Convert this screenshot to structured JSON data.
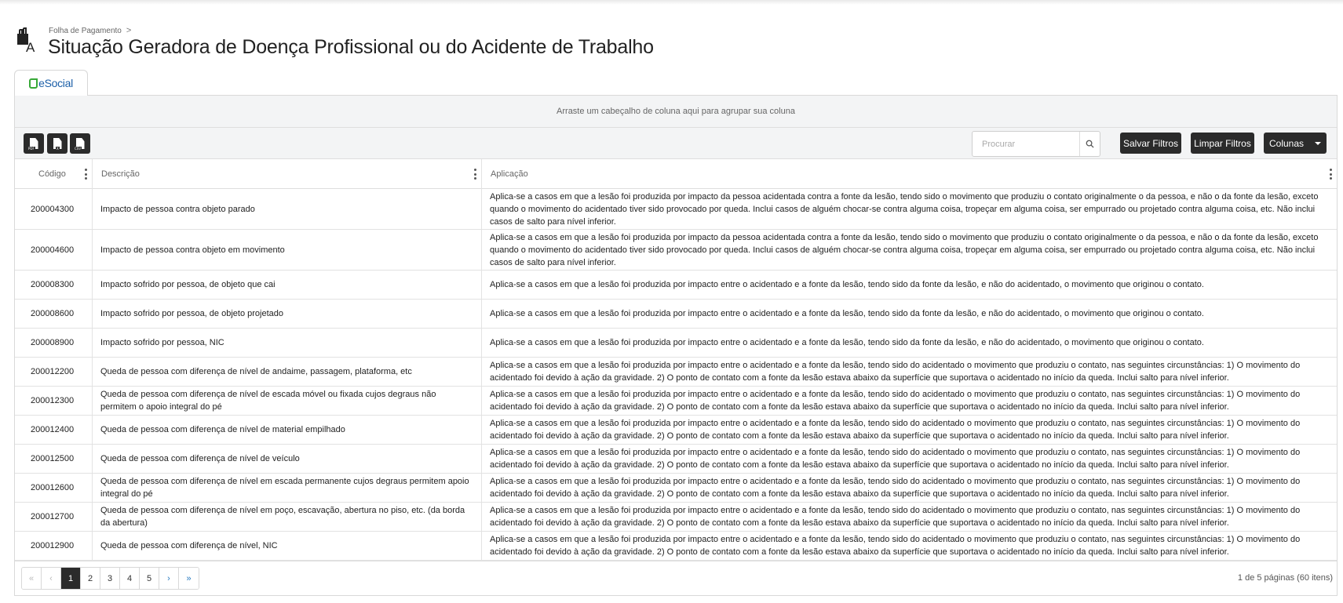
{
  "breadcrumb": {
    "parent": "Folha de Pagamento",
    "separator": ">"
  },
  "page_title": "Situação Geradora de Doença Profissional ou do Acidente de Trabalho",
  "tabs": [
    {
      "label": "eSocial",
      "icon": "esocial-logo"
    }
  ],
  "grid": {
    "group_hint": "Arraste um cabeçalho de coluna aqui para agrupar sua coluna",
    "export_buttons": [
      {
        "name": "export-pdf-button",
        "icon": "pdf-file-icon",
        "tag": "PDF"
      },
      {
        "name": "export-xls-button",
        "icon": "excel-file-icon",
        "tag": "X"
      },
      {
        "name": "export-csv-button",
        "icon": "csv-file-icon",
        "tag": "CSV"
      }
    ],
    "search": {
      "placeholder": "Procurar",
      "value": "",
      "icon": "search-icon"
    },
    "buttons": {
      "save_filters": "Salvar Filtros",
      "clear_filters": "Limpar Filtros",
      "columns": "Colunas"
    },
    "columns": [
      {
        "label": "Código"
      },
      {
        "label": "Descrição"
      },
      {
        "label": "Aplicação"
      }
    ],
    "rows": [
      {
        "code": "200004300",
        "desc": "Impacto de pessoa contra objeto parado",
        "app": "Aplica-se a casos em que a lesão foi produzida por impacto da pessoa acidentada contra a fonte da lesão, tendo sido o movimento que produziu o contato originalmente o da pessoa, e não o da fonte da lesão, exceto quando o movimento do acidentado tiver sido provocado por queda. Inclui casos de alguém chocar-se contra alguma coisa, tropeçar em alguma coisa, ser empurrado ou projetado contra alguma coisa, etc. Não inclui casos de salto para nível inferior."
      },
      {
        "code": "200004600",
        "desc": "Impacto de pessoa contra objeto em movimento",
        "app": "Aplica-se a casos em que a lesão foi produzida por impacto da pessoa acidentada contra a fonte da lesão, tendo sido o movimento que produziu o contato originalmente o da pessoa, e não o da fonte da lesão, exceto quando o movimento do acidentado tiver sido provocado por queda. Inclui casos de alguém chocar-se contra alguma coisa, tropeçar em alguma coisa, ser empurrado ou projetado contra alguma coisa, etc. Não inclui casos de salto para nível inferior."
      },
      {
        "code": "200008300",
        "desc": "Impacto sofrido por pessoa, de objeto que cai",
        "app": "Aplica-se a casos em que a lesão foi produzida por impacto entre o acidentado e a fonte da lesão, tendo sido da fonte da lesão, e não do acidentado, o movimento que originou o contato."
      },
      {
        "code": "200008600",
        "desc": "Impacto sofrido por pessoa, de objeto projetado",
        "app": "Aplica-se a casos em que a lesão foi produzida por impacto entre o acidentado e a fonte da lesão, tendo sido da fonte da lesão, e não do acidentado, o movimento que originou o contato."
      },
      {
        "code": "200008900",
        "desc": "Impacto sofrido por pessoa, NIC",
        "app": "Aplica-se a casos em que a lesão foi produzida por impacto entre o acidentado e a fonte da lesão, tendo sido da fonte da lesão, e não do acidentado, o movimento que originou o contato."
      },
      {
        "code": "200012200",
        "desc": "Queda de pessoa com diferença de nível de andaime, passagem, plataforma, etc",
        "app": "Aplica-se a casos em que a lesão foi produzida por impacto entre o acidentado e a fonte da lesão, tendo sido do acidentado o movimento que produziu o contato, nas seguintes circunstâncias: 1) O movimento do acidentado foi devido à ação da gravidade. 2) O ponto de contato com a fonte da lesão estava abaixo da superfície que suportava o acidentado no início da queda. Inclui salto para nível inferior."
      },
      {
        "code": "200012300",
        "desc": "Queda de pessoa com diferença de nível de escada móvel ou fixada cujos degraus não permitem o apoio integral do pé",
        "app": "Aplica-se a casos em que a lesão foi produzida por impacto entre o acidentado e a fonte da lesão, tendo sido do acidentado o movimento que produziu o contato, nas seguintes circunstâncias: 1) O movimento do acidentado foi devido à ação da gravidade. 2) O ponto de contato com a fonte da lesão estava abaixo da superfície que suportava o acidentado no início da queda. Inclui salto para nível inferior."
      },
      {
        "code": "200012400",
        "desc": "Queda de pessoa com diferença de nível de material empilhado",
        "app": "Aplica-se a casos em que a lesão foi produzida por impacto entre o acidentado e a fonte da lesão, tendo sido do acidentado o movimento que produziu o contato, nas seguintes circunstâncias: 1) O movimento do acidentado foi devido à ação da gravidade. 2) O ponto de contato com a fonte da lesão estava abaixo da superfície que suportava o acidentado no início da queda. Inclui salto para nível inferior."
      },
      {
        "code": "200012500",
        "desc": "Queda de pessoa com diferença de nível de veículo",
        "app": "Aplica-se a casos em que a lesão foi produzida por impacto entre o acidentado e a fonte da lesão, tendo sido do acidentado o movimento que produziu o contato, nas seguintes circunstâncias: 1) O movimento do acidentado foi devido à ação da gravidade. 2) O ponto de contato com a fonte da lesão estava abaixo da superfície que suportava o acidentado no início da queda. Inclui salto para nível inferior."
      },
      {
        "code": "200012600",
        "desc": "Queda de pessoa com diferença de nível em escada permanente cujos degraus permitem apoio integral do pé",
        "app": "Aplica-se a casos em que a lesão foi produzida por impacto entre o acidentado e a fonte da lesão, tendo sido do acidentado o movimento que produziu o contato, nas seguintes circunstâncias: 1) O movimento do acidentado foi devido à ação da gravidade. 2) O ponto de contato com a fonte da lesão estava abaixo da superfície que suportava o acidentado no início da queda. Inclui salto para nível inferior."
      },
      {
        "code": "200012700",
        "desc": "Queda de pessoa com diferença de nível em poço, escavação, abertura no piso, etc. (da borda da abertura)",
        "app": "Aplica-se a casos em que a lesão foi produzida por impacto entre o acidentado e a fonte da lesão, tendo sido do acidentado o movimento que produziu o contato, nas seguintes circunstâncias: 1) O movimento do acidentado foi devido à ação da gravidade. 2) O ponto de contato com a fonte da lesão estava abaixo da superfície que suportava o acidentado no início da queda. Inclui salto para nível inferior."
      },
      {
        "code": "200012900",
        "desc": "Queda de pessoa com diferença de nível, NIC",
        "app": "Aplica-se a casos em que a lesão foi produzida por impacto entre o acidentado e a fonte da lesão, tendo sido do acidentado o movimento que produziu o contato, nas seguintes circunstâncias: 1) O movimento do acidentado foi devido à ação da gravidade. 2) O ponto de contato com a fonte da lesão estava abaixo da superfície que suportava o acidentado no início da queda. Inclui salto para nível inferior."
      }
    ],
    "pager": {
      "first": "«",
      "prev": "‹",
      "pages": [
        "1",
        "2",
        "3",
        "4",
        "5"
      ],
      "active_page": "1",
      "next": "›",
      "last": "»",
      "info": "1 de 5 páginas (60 itens)"
    }
  },
  "colors": {
    "dark_button": "#2b2b2b",
    "esocial_green": "#38a838",
    "esocial_blue": "#1c5fa8",
    "link_blue": "#2a7cc2"
  }
}
